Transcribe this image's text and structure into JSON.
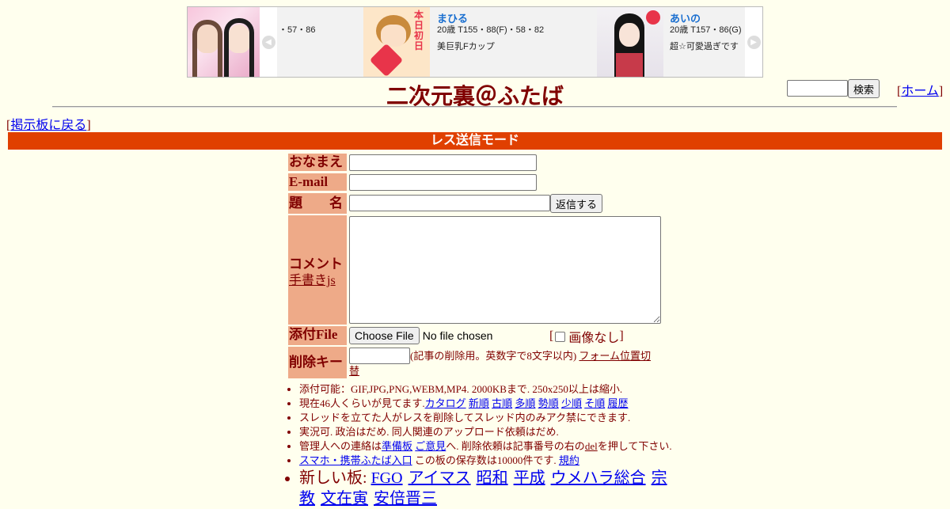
{
  "ad": {
    "card1": {
      "spec_tail": "・57・86"
    },
    "card2": {
      "name": "まひる",
      "spec": "20歳 T155・88(F)・58・82",
      "desc": "美巨乳Fカップ"
    },
    "card3": {
      "name": "あいの",
      "spec": "20歳 T157・86(G)",
      "desc": "超☆可愛過ぎです"
    }
  },
  "header": {
    "title": "二次元裏＠ふたば",
    "search_button": "検索",
    "home_link": "ホーム"
  },
  "nav": {
    "back_link": "掲示板に戻る"
  },
  "mode_bar": "レス送信モード",
  "form": {
    "name_label": "おなまえ",
    "email_label": "E-mail",
    "subject_label": "題　　名",
    "submit_button": "返信する",
    "comment_label": "コメント",
    "handwriting_link": "手書きjs",
    "file_label": "添付File",
    "file_button": "Choose File",
    "file_status": "No file chosen",
    "no_image_label": "画像なし",
    "delete_key_label": "削除キー",
    "delete_key_note": "(記事の削除用。英数字で8文字以内)",
    "form_position_link": "フォーム位置切替"
  },
  "notes": {
    "n1": "添付可能：GIF,JPG,PNG,WEBM,MP4. 2000KBまで. 250x250以上は縮小.",
    "n2_prefix": "現在46人くらいが見てます.",
    "n2_links": [
      "カタログ",
      "新順",
      "古順",
      "多順",
      "勢順",
      "少順",
      "そ順",
      "履歴"
    ],
    "n3": "スレッドを立てた人がレスを削除してスレッド内のみアク禁にできます.",
    "n4": "実況可. 政治はだめ. 同人関連のアップロード依頼はだめ.",
    "n5_a": "管理人への連絡は",
    "n5_link1": "準備板",
    "n5_link2": "ご意見",
    "n5_b": "へ. 削除依頼は記事番号の右の",
    "n5_del": "del",
    "n5_c": "を押して下さい.",
    "n6_link": "スマホ・携帯ふたば入口",
    "n6_text": "この板の保存数は10000件です.",
    "n6_terms": "規約",
    "new_boards_label": "新しい板:",
    "new_boards": [
      "FGO",
      "アイマス",
      "昭和",
      "平成",
      "ウメハラ総合",
      "宗教",
      "文在寅",
      "安倍晋三"
    ]
  }
}
